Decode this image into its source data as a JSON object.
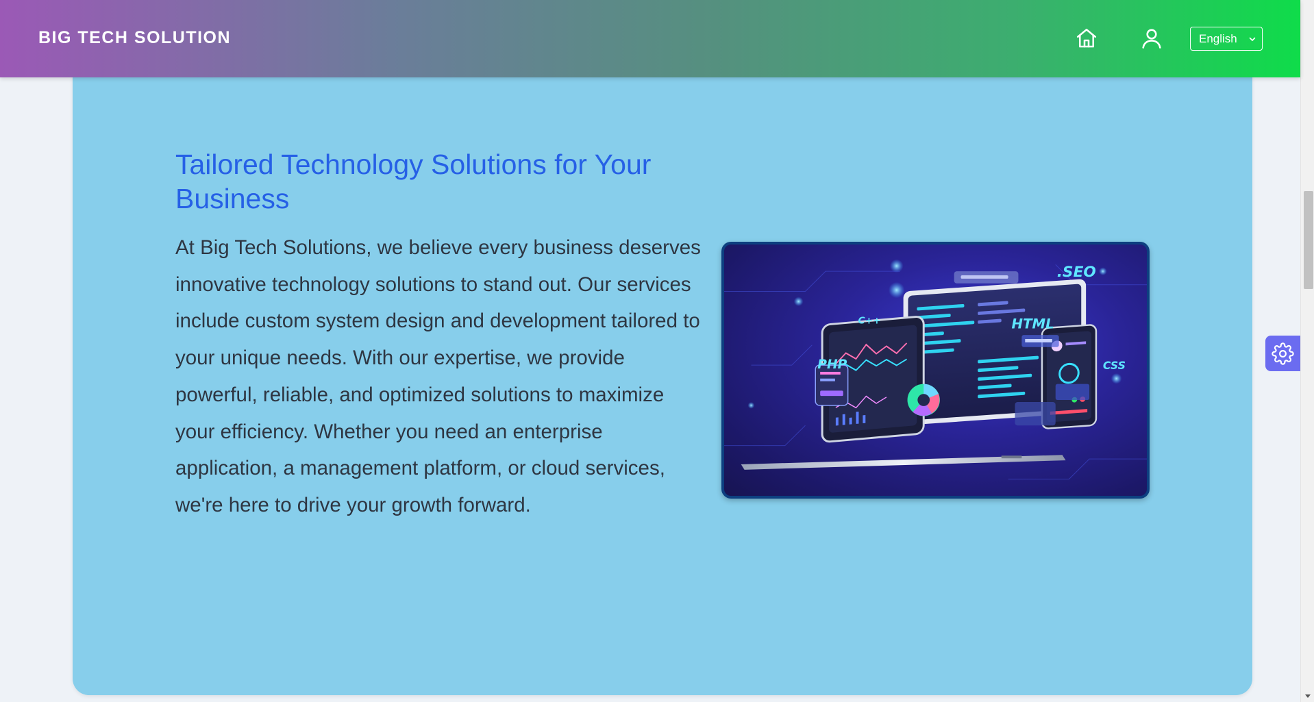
{
  "header": {
    "brand": "BIG TECH SOLUTION",
    "home_icon": "home-icon",
    "user_icon": "user-icon",
    "language": {
      "selected": "English",
      "icon": "chevron-down-icon"
    }
  },
  "main": {
    "title": "Tailored Technology Solutions for Your Business",
    "body": "At Big Tech Solutions, we believe every business deserves innovative technology solutions to stand out. Our services include custom system design and development tailored to your unique needs. With our expertise, we provide powerful, reliable, and optimized solutions to maximize your efficiency. Whether you need an enterprise application, a management platform, or cloud services, we're here to drive your growth forward.",
    "illustration": {
      "labels": {
        "seo": ".SEO",
        "cpp": "C++",
        "html": "HTML",
        "php": "PHP",
        "css": "CSS"
      }
    }
  },
  "floating": {
    "settings_icon": "gear-icon"
  },
  "colors": {
    "header_gradient_start": "#9b59b6",
    "header_gradient_end": "#0fdc4a",
    "card_background": "#87ceeb",
    "title": "#2660e6",
    "body_text": "#2e3642",
    "settings_button": "#6b6cf0",
    "page_background": "#eef2f7"
  }
}
